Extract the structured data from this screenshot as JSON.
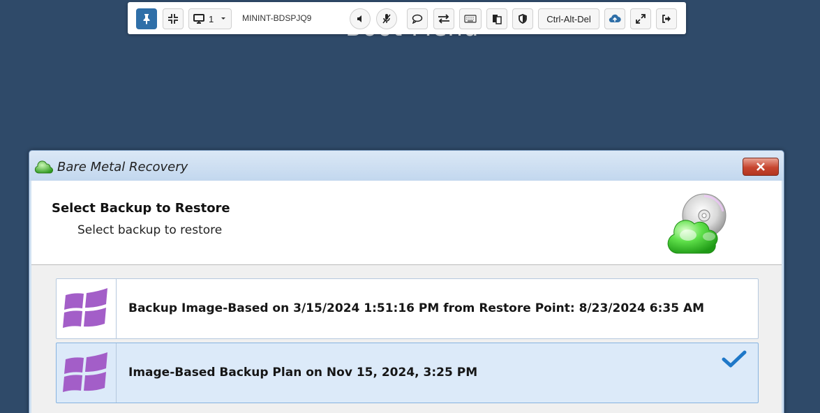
{
  "background": {
    "title": "Boot Menu"
  },
  "toolbar": {
    "monitor_number": "1",
    "machine_name": "MININT-BDSPJQ9",
    "ctrl_alt_del_label": "Ctrl-Alt-Del",
    "icons": [
      "pin-icon",
      "compress-icon",
      "monitor-icon",
      "speaker-icon",
      "mic-muted-icon",
      "chat-icon",
      "swap-icon",
      "keyboard-icon",
      "clipboard-icon",
      "shield-icon",
      "upload-cloud-icon",
      "expand-icon",
      "exit-icon"
    ],
    "accent_color": "#2f6fa8"
  },
  "dialog": {
    "title": "Bare Metal Recovery",
    "header_title": "Select Backup to Restore",
    "header_subtitle": "Select backup to restore",
    "backups": [
      {
        "label": "Backup Image-Based on 3/15/2024 1:51:16 PM from Restore Point: 8/23/2024 6:35 AM",
        "selected": false
      },
      {
        "label": "Image-Based Backup Plan on Nov 15, 2024, 3:25 PM",
        "selected": true
      }
    ],
    "windows_logo_color": "#a35ec8",
    "check_color": "#1f78c8"
  }
}
